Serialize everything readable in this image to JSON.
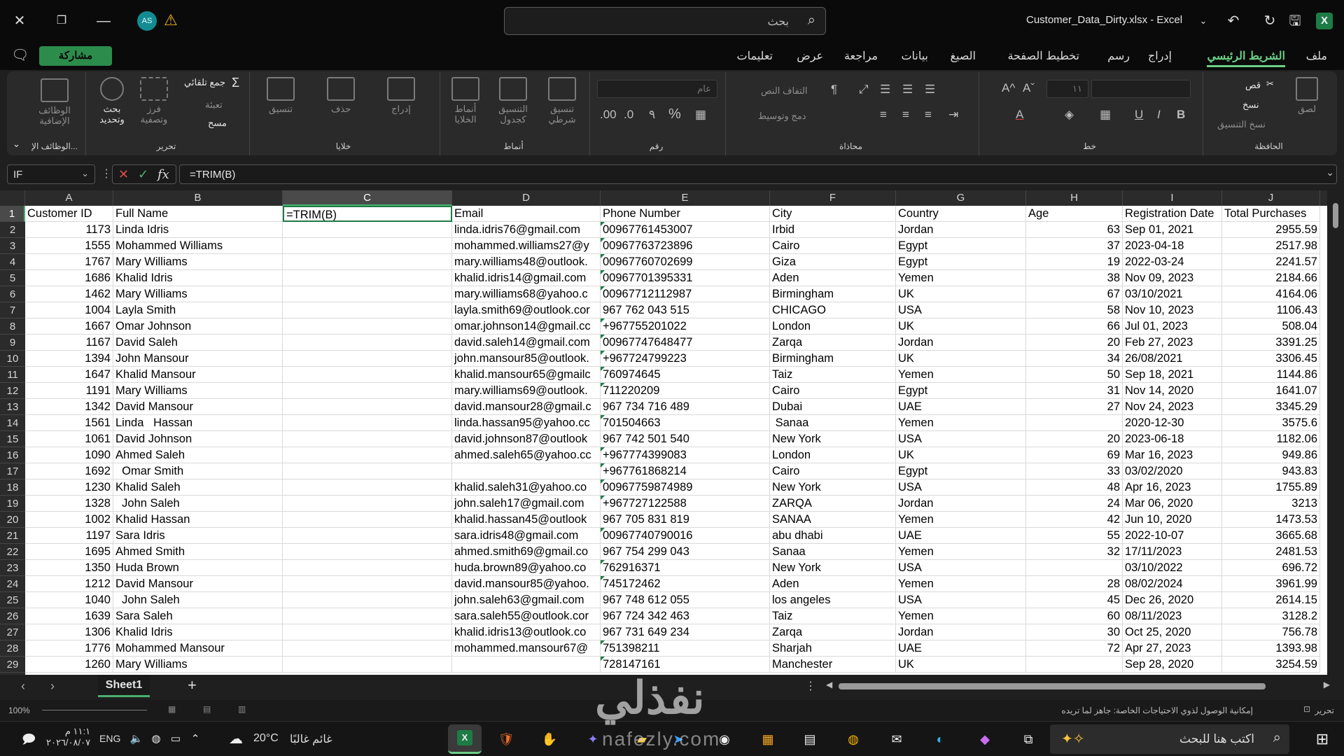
{
  "titlebar": {
    "filename": "Customer_Data_Dirty.xlsx  -  Excel",
    "search_placeholder": "بحث",
    "avatar_initials": "AS",
    "app_letter": "X"
  },
  "tabs": [
    {
      "label": "ملف"
    },
    {
      "label": "الشريط الرئيسي"
    },
    {
      "label": "إدراج"
    },
    {
      "label": "رسم"
    },
    {
      "label": "تخطيط الصفحة"
    },
    {
      "label": "الصيغ"
    },
    {
      "label": "بيانات"
    },
    {
      "label": "مراجعة"
    },
    {
      "label": "عرض"
    },
    {
      "label": "تعليمات"
    }
  ],
  "share_label": "مشاركة",
  "ribbon": {
    "clipboard": {
      "label": "الحافظة",
      "paste": "لصق",
      "cut": "قص",
      "copy": "نسخ",
      "format_painter": "نسخ التنسيق"
    },
    "font": {
      "label": "خط",
      "size": "١١",
      "bold": "B",
      "italic": "I",
      "underline": "U"
    },
    "alignment": {
      "label": "محاذاة",
      "wrap": "التفاف النص",
      "merge": "دمج وتوسيط"
    },
    "number": {
      "label": "رقم",
      "format": "عام",
      "percent": "%",
      "comma": "٩"
    },
    "styles": {
      "label": "أنماط",
      "conditional": "تنسيق شرطي",
      "table": "التنسيق كجدول",
      "cell_styles": "أنماط الخلايا"
    },
    "cells": {
      "label": "خلايا",
      "insert": "إدراج",
      "delete": "حذف",
      "format": "تنسيق"
    },
    "editing": {
      "label": "تحرير",
      "autosum": "جمع تلقائي",
      "fill": "تعبئة",
      "clear": "مسح",
      "sort": "فرز وتصفية",
      "find": "بحث وتحديد"
    },
    "addins": {
      "label": "الوظائف الإ...",
      "button": "الوظائف الإضافية"
    }
  },
  "formula_bar": {
    "name_box": "IF",
    "formula": "=TRIM(B)"
  },
  "columns": [
    "A",
    "B",
    "C",
    "D",
    "E",
    "F",
    "G",
    "H",
    "I",
    "J"
  ],
  "selected_column": "C",
  "sheet": {
    "rows": [
      {
        "n": "1",
        "cells": [
          "Customer ID",
          "Full Name",
          "=TRIM(B)",
          "Email",
          "Phone Number",
          "City",
          "Country",
          "Age",
          "Registration Date",
          "Total Purchases"
        ]
      },
      {
        "n": "2",
        "cells": [
          "1173",
          "Linda Idris",
          "",
          "linda.idris76@gmail.com",
          "00967761453007",
          "Irbid",
          "Jordan",
          "63",
          "Sep 01, 2021",
          "2955.59"
        ]
      },
      {
        "n": "3",
        "cells": [
          "1555",
          "Mohammed Williams",
          "",
          "mohammed.williams27@y",
          "00967763723896",
          "Cairo",
          "Egypt",
          "37",
          "2023-04-18",
          "2517.98"
        ]
      },
      {
        "n": "4",
        "cells": [
          "1767",
          "Mary Williams",
          "",
          "mary.williams48@outlook.",
          "00967760702699",
          "Giza",
          "Egypt",
          "19",
          "2022-03-24",
          "2241.57"
        ]
      },
      {
        "n": "5",
        "cells": [
          "1686",
          "Khalid Idris",
          "",
          "khalid.idris14@gmail.com",
          "00967701395331",
          "Aden",
          "Yemen",
          "38",
          "Nov 09, 2023",
          "2184.66"
        ]
      },
      {
        "n": "6",
        "cells": [
          "1462",
          "Mary Williams",
          "",
          "mary.williams68@yahoo.c",
          "00967712112987",
          "Birmingham",
          "UK",
          "67",
          "03/10/2021",
          "4164.06"
        ]
      },
      {
        "n": "7",
        "cells": [
          "1004",
          "Layla Smith",
          "",
          "layla.smith69@outlook.cor",
          "967 762 043 515",
          "CHICAGO",
          "USA",
          "58",
          "Nov 10, 2023",
          "1106.43"
        ]
      },
      {
        "n": "8",
        "cells": [
          "1667",
          "Omar Johnson",
          "",
          "omar.johnson14@gmail.cc",
          "+967755201022",
          "London",
          "UK",
          "66",
          "Jul 01, 2023",
          "508.04"
        ]
      },
      {
        "n": "9",
        "cells": [
          "1167",
          "David Saleh",
          "",
          "david.saleh14@gmail.com",
          "00967747648477",
          "Zarqa",
          "Jordan",
          "20",
          "Feb 27, 2023",
          "3391.25"
        ]
      },
      {
        "n": "10",
        "cells": [
          "1394",
          "John Mansour",
          "",
          "john.mansour85@outlook.",
          "+967724799223",
          "Birmingham",
          "UK",
          "34",
          "26/08/2021",
          "3306.45"
        ]
      },
      {
        "n": "11",
        "cells": [
          "1647",
          "Khalid Mansour",
          "",
          "khalid.mansour65@gmailc",
          "760974645",
          "Taiz",
          "Yemen",
          "50",
          "Sep 18, 2021",
          "1144.86"
        ]
      },
      {
        "n": "12",
        "cells": [
          "1191",
          "Mary Williams",
          "",
          "mary.williams69@outlook.",
          "711220209",
          "Cairo",
          "Egypt",
          "31",
          "Nov 14, 2020",
          "1641.07"
        ]
      },
      {
        "n": "13",
        "cells": [
          "1342",
          "David Mansour",
          "",
          "david.mansour28@gmail.c",
          "967 734 716 489",
          "Dubai",
          "UAE",
          "27",
          "Nov 24, 2023",
          "3345.29"
        ]
      },
      {
        "n": "14",
        "cells": [
          "1561",
          "Linda   Hassan",
          "",
          "linda.hassan95@yahoo.cc",
          "701504663",
          " Sanaa",
          "Yemen",
          "",
          "2020-12-30",
          "3575.6"
        ]
      },
      {
        "n": "15",
        "cells": [
          "1061",
          "David Johnson",
          "",
          "david.johnson87@outlook",
          "967 742 501 540",
          "New York",
          "USA",
          "20",
          "2023-06-18",
          "1182.06"
        ]
      },
      {
        "n": "16",
        "cells": [
          "1090",
          "Ahmed Saleh",
          "",
          "ahmed.saleh65@yahoo.cc",
          "+967774399083",
          "London",
          "UK",
          "69",
          "Mar 16, 2023",
          "949.86"
        ]
      },
      {
        "n": "17",
        "cells": [
          "1692",
          "  Omar Smith",
          "",
          "",
          "+967761868214",
          "Cairo",
          "Egypt",
          "33",
          "03/02/2020",
          "943.83"
        ]
      },
      {
        "n": "18",
        "cells": [
          "1230",
          "Khalid Saleh",
          "",
          "khalid.saleh31@yahoo.co",
          "00967759874989",
          "New York",
          "USA",
          "48",
          "Apr 16, 2023",
          "1755.89"
        ]
      },
      {
        "n": "19",
        "cells": [
          "1328",
          "  John Saleh",
          "",
          "john.saleh17@gmail.com",
          "+967727122588",
          "ZARQA",
          "Jordan",
          "24",
          "Mar 06, 2020",
          "3213"
        ]
      },
      {
        "n": "20",
        "cells": [
          "1002",
          "Khalid Hassan",
          "",
          "khalid.hassan45@outlook",
          "967 705 831 819",
          "SANAA",
          "Yemen",
          "42",
          "Jun 10, 2020",
          "1473.53"
        ]
      },
      {
        "n": "21",
        "cells": [
          "1197",
          "Sara Idris",
          "",
          "sara.idris48@gmail.com",
          "00967740790016",
          "abu dhabi",
          "UAE",
          "55",
          "2022-10-07",
          "3665.68"
        ]
      },
      {
        "n": "22",
        "cells": [
          "1695",
          "Ahmed Smith",
          "",
          "ahmed.smith69@gmail.co",
          "967 754 299 043",
          "Sanaa",
          "Yemen",
          "32",
          "17/11/2023",
          "2481.53"
        ]
      },
      {
        "n": "23",
        "cells": [
          "1350",
          "Huda Brown",
          "",
          "huda.brown89@yahoo.co",
          "762916371",
          "New York",
          "USA",
          "",
          "03/10/2022",
          "696.72"
        ]
      },
      {
        "n": "24",
        "cells": [
          "1212",
          "David Mansour",
          "",
          "david.mansour85@yahoo.",
          "745172462",
          "Aden",
          "Yemen",
          "28",
          "08/02/2024",
          "3961.99"
        ]
      },
      {
        "n": "25",
        "cells": [
          "1040",
          "  John Saleh",
          "",
          "john.saleh63@gmail.com",
          "967 748 612 055",
          "los angeles",
          "USA",
          "45",
          "Dec 26, 2020",
          "2614.15"
        ]
      },
      {
        "n": "26",
        "cells": [
          "1639",
          "Sara Saleh",
          "",
          "sara.saleh55@outlook.cor",
          "967 724 342 463",
          "Taiz",
          "Yemen",
          "60",
          "08/11/2023",
          "3128.2"
        ]
      },
      {
        "n": "27",
        "cells": [
          "1306",
          "Khalid Idris",
          "",
          "khalid.idris13@outlook.co",
          "967 731 649 234",
          "Zarqa",
          "Jordan",
          "30",
          "Oct 25, 2020",
          "756.78"
        ]
      },
      {
        "n": "28",
        "cells": [
          "1776",
          "Mohammed Mansour",
          "",
          "mohammed.mansour67@",
          "751398211",
          "Sharjah",
          "UAE",
          "72",
          "Apr 27, 2023",
          "1393.98"
        ]
      },
      {
        "n": "29",
        "cells": [
          "1260",
          "Mary Williams",
          "",
          "",
          "728147161",
          "Manchester",
          "UK",
          "",
          "Sep 28, 2020",
          "3254.59"
        ]
      }
    ]
  },
  "sheet_tab": "Sheet1",
  "statusbar": {
    "mode": "تحرير",
    "accessibility": "إمكانية الوصول لذوي الاحتياجات الخاصة: جاهز لما تريده",
    "zoom": "100%"
  },
  "taskbar": {
    "search_placeholder": "اكتب هنا للبحث",
    "weather_temp": "20°C",
    "weather_text": "غائم غالبًا",
    "lang": "ENG",
    "time": "١١:١ م",
    "date": "٢٠٢٦/٠٨/٠٧"
  },
  "watermark": {
    "text": "نفذلي",
    "url": "nafezly.com"
  },
  "colors": {
    "accent": "#1e7b45",
    "tab_active": "#6ccf86",
    "share": "#2c8c4c"
  }
}
